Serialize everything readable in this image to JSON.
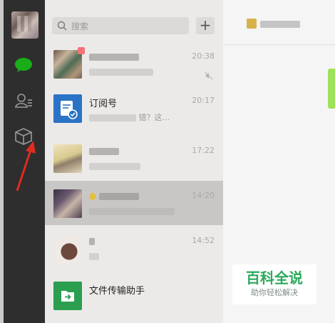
{
  "search": {
    "placeholder": "搜索",
    "add": "+"
  },
  "conversations": [
    {
      "name": "",
      "preview": "",
      "time": "20:38",
      "muted": true
    },
    {
      "name": "订阅号",
      "preview": "错？这...",
      "time": "20:17"
    },
    {
      "name": "",
      "preview": "",
      "time": "17:22"
    },
    {
      "name": "",
      "preview": "",
      "time": "14:20",
      "active": true
    },
    {
      "name": "",
      "preview": "",
      "time": "14:52"
    },
    {
      "name": "文件传输助手",
      "preview": "",
      "time": ""
    }
  ],
  "colors": {
    "rail": "#2e2e2e",
    "chat_green": "#1aad19",
    "accent_green": "#2aaa5c",
    "sub_blue": "#2b73c7"
  },
  "icons": [
    "chat-icon",
    "contacts-icon",
    "box-icon",
    "search-icon",
    "plus-icon",
    "mute-icon",
    "file-transfer-icon",
    "subscription-icon"
  ],
  "watermark": {
    "title": "百科全说",
    "subtitle": "助你轻松解决"
  }
}
